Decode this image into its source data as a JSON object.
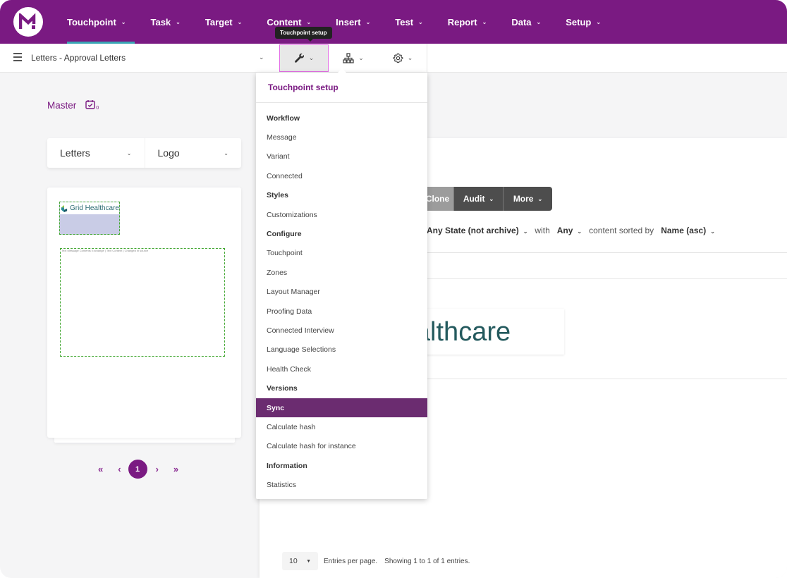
{
  "colors": {
    "brand": "#7a1a82",
    "nav_active_underline": "#3aa6b5",
    "menu_selected": "#6b2c70",
    "zone_border": "#44a834"
  },
  "topnav": {
    "logo_icon": "messagepoint-logo-icon",
    "items": [
      {
        "label": "Touchpoint",
        "active": true
      },
      {
        "label": "Task"
      },
      {
        "label": "Target"
      },
      {
        "label": "Content"
      },
      {
        "label": "Insert"
      },
      {
        "label": "Test"
      },
      {
        "label": "Report"
      },
      {
        "label": "Data"
      },
      {
        "label": "Setup"
      }
    ]
  },
  "subbar": {
    "menu_icon": "hamburger-icon",
    "breadcrumb": "Letters - Approval Letters",
    "tools": [
      {
        "icon": "wrench-icon",
        "active": true
      },
      {
        "icon": "hierarchy-icon"
      },
      {
        "icon": "gear-icon"
      }
    ],
    "tooltip": "Touchpoint setup"
  },
  "left_panel": {
    "master_label": "Master",
    "master_icon": "calendar-check-icon",
    "master_count": "0",
    "selects": [
      {
        "value": "Letters"
      },
      {
        "value": "Logo"
      }
    ],
    "preview": {
      "logo_text": "Grid Healthcare",
      "zone_caption": "Text Message Contents Exchange | Text Content | Changed in source"
    },
    "pagination": {
      "first": "«",
      "prev": "‹",
      "current": "1",
      "next": "›",
      "last": "»"
    }
  },
  "content": {
    "buttons": [
      {
        "label": "Clone"
      },
      {
        "label": "Audit"
      },
      {
        "label": "More"
      }
    ],
    "filter": {
      "state_value": "Any State (not archive)",
      "with_label": "with",
      "with_value": "Any",
      "sorted_label": "content sorted by",
      "sort_value": "Name (asc)"
    },
    "logo_preview_text": "Grid Healthcare",
    "footer": {
      "entries_per_page": "10",
      "entries_label": "Entries per page.",
      "showing_text": "Showing 1 to 1 of 1 entries."
    }
  },
  "menu": {
    "title": "Touchpoint setup",
    "items": [
      {
        "label": "Workflow",
        "type": "header"
      },
      {
        "label": "Message",
        "type": "link"
      },
      {
        "label": "Variant",
        "type": "link"
      },
      {
        "label": "Connected",
        "type": "link"
      },
      {
        "label": "Styles",
        "type": "header"
      },
      {
        "label": "Customizations",
        "type": "link"
      },
      {
        "label": "Configure",
        "type": "header"
      },
      {
        "label": "Touchpoint",
        "type": "link"
      },
      {
        "label": "Zones",
        "type": "link"
      },
      {
        "label": "Layout Manager",
        "type": "link"
      },
      {
        "label": "Proofing Data",
        "type": "link"
      },
      {
        "label": "Connected Interview",
        "type": "link"
      },
      {
        "label": "Language Selections",
        "type": "link"
      },
      {
        "label": "Health Check",
        "type": "link"
      },
      {
        "label": "Versions",
        "type": "header"
      },
      {
        "label": "Sync",
        "type": "link",
        "selected": true
      },
      {
        "label": "Calculate hash",
        "type": "link"
      },
      {
        "label": "Calculate hash for instance",
        "type": "link"
      },
      {
        "label": "Information",
        "type": "header"
      },
      {
        "label": "Statistics",
        "type": "link"
      }
    ]
  }
}
